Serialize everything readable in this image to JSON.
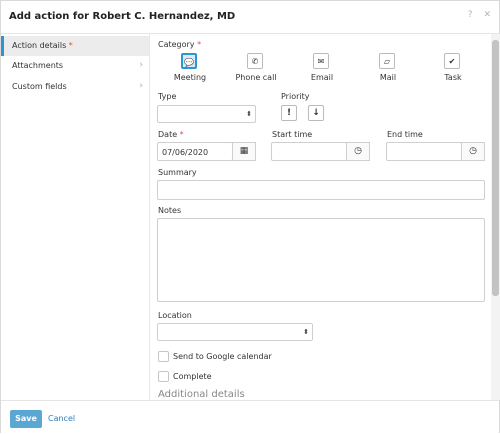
{
  "dialog": {
    "title": "Add action for Robert C. Hernandez, MD",
    "help_icon": "question-icon",
    "close_icon": "close-icon"
  },
  "sidebar": {
    "items": [
      {
        "label": "Action details",
        "required": "*",
        "active": true
      },
      {
        "label": "Attachments",
        "chevron": "›"
      },
      {
        "label": "Custom fields",
        "chevron": "›"
      }
    ]
  },
  "form": {
    "category_label": "Category",
    "required_mark": "*",
    "categories": [
      {
        "label": "Meeting",
        "icon": "chat-bubble-icon",
        "glyph": "💬"
      },
      {
        "label": "Phone call",
        "icon": "phone-icon",
        "glyph": "✆"
      },
      {
        "label": "Email",
        "icon": "envelope-icon",
        "glyph": "✉"
      },
      {
        "label": "Mail",
        "icon": "note-icon",
        "glyph": "▱"
      },
      {
        "label": "Task",
        "icon": "checkmark-icon",
        "glyph": "✔"
      }
    ],
    "selected_category": "Meeting",
    "type_label": "Type",
    "type_value": "",
    "priority_label": "Priority",
    "priority_high_glyph": "!",
    "priority_low_glyph": "↓",
    "date_label": "Date",
    "date_value": "07/06/2020",
    "calendar_glyph": "▦",
    "start_time_label": "Start time",
    "end_time_label": "End time",
    "clock_glyph": "◷",
    "summary_label": "Summary",
    "notes_label": "Notes",
    "location_label": "Location",
    "google_calendar_label": "Send to Google calendar",
    "complete_label": "Complete",
    "additional_details_label": "Additional details",
    "caret_glyph": "⬍"
  },
  "footer": {
    "save_label": "Save",
    "cancel_label": "Cancel"
  },
  "colors": {
    "accent": "#2f95ce",
    "save_button": "#5aa7d3",
    "link": "#2f7fbc",
    "required": "#d9534f"
  }
}
